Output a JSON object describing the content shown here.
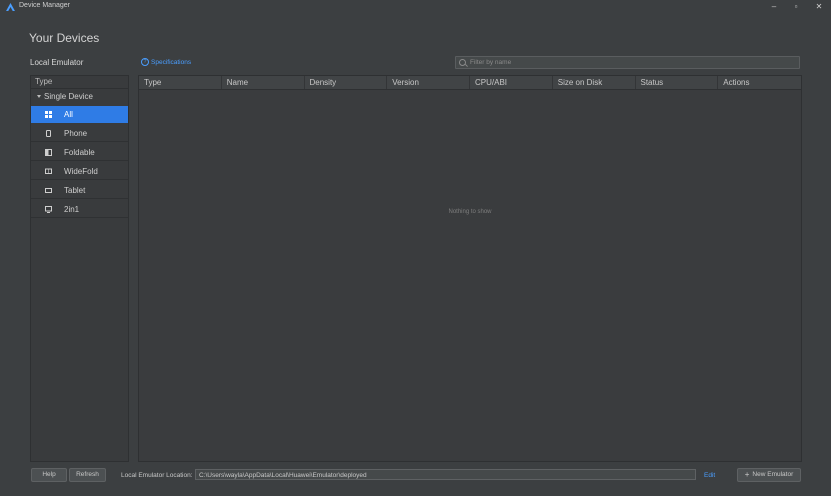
{
  "window": {
    "title": "Device Manager",
    "buttons": {
      "minimize": "–",
      "maximize": "▫",
      "close": "✕"
    }
  },
  "header": {
    "page_title": "Your Devices",
    "local_emulator_label": "Local Emulator",
    "specifications_link": "Specifications",
    "search_placeholder": "Filter by name"
  },
  "sidebar": {
    "header": "Type",
    "group": "Single Device",
    "items": [
      {
        "label": "All",
        "icon": "grid-icon",
        "selected": true
      },
      {
        "label": "Phone",
        "icon": "phone-icon",
        "selected": false
      },
      {
        "label": "Foldable",
        "icon": "foldable-icon",
        "selected": false
      },
      {
        "label": "WideFold",
        "icon": "widefold-icon",
        "selected": false
      },
      {
        "label": "Tablet",
        "icon": "tablet-icon",
        "selected": false
      },
      {
        "label": "2in1",
        "icon": "monitor-icon",
        "selected": false
      }
    ]
  },
  "table": {
    "columns": [
      "Type",
      "Name",
      "Density",
      "Version",
      "CPU/ABI",
      "Size on Disk",
      "Status",
      "Actions"
    ],
    "empty_text": "Nothing to show"
  },
  "footer": {
    "help_label": "Help",
    "refresh_label": "Refresh",
    "location_label": "Local Emulator Location:",
    "location_value": "C:\\Users\\wayla\\AppData\\Local\\Huawei\\Emulator\\deployed",
    "edit_label": "Edit",
    "new_emulator_label": "New Emulator"
  },
  "colors": {
    "background": "#3c3f41",
    "accent": "#2f7ce6",
    "link": "#4a9eff"
  }
}
